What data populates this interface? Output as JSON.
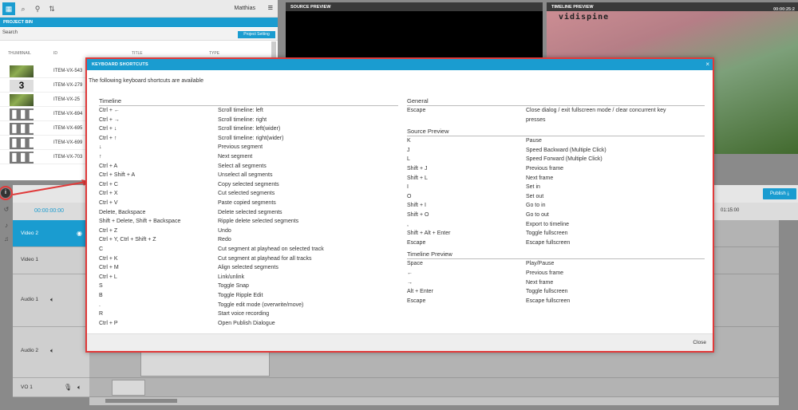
{
  "bin": {
    "user": "Matthias",
    "header": "PROJECT BIN",
    "search_placeholder": "Search",
    "settings_button": "Project Setting",
    "columns": [
      "THUMBNAIL",
      "ID",
      "TITLE",
      "TYPE"
    ],
    "rows": [
      {
        "thumb": "image",
        "id": "ITEM-VX-543"
      },
      {
        "thumb": "number",
        "thumb_text": "3",
        "id": "ITEM-VX-279"
      },
      {
        "thumb": "image",
        "id": "ITEM-VX-25"
      },
      {
        "thumb": "audio",
        "id": "ITEM-VX-694"
      },
      {
        "thumb": "audio",
        "id": "ITEM-VX-695"
      },
      {
        "thumb": "audio",
        "id": "ITEM-VX-699"
      },
      {
        "thumb": "audio",
        "id": "ITEM-VX-703"
      }
    ]
  },
  "previews": {
    "source_title": "SOURCE PREVIEW",
    "timeline_title": "TIMELINE PREVIEW",
    "timeline_time": "00:00:25:2",
    "logo_text": "vidispine"
  },
  "timeline": {
    "publish_label": "Publish",
    "start_time": "00:00:00:00",
    "end_time": "01:15:00",
    "tracks": [
      "Video 2",
      "Video 1",
      "Audio 1",
      "Audio 2",
      "VO 1"
    ]
  },
  "dialog": {
    "title": "KEYBOARD SHORTCUTS",
    "subtitle": "The following keyboard shortcuts are available",
    "close_label": "Close",
    "left_sections": [
      {
        "title": "Timeline",
        "items": [
          {
            "key": "Ctrl + ←",
            "desc": "Scroll timeline: left"
          },
          {
            "key": "Ctrl + →",
            "desc": "Scroll timeline: right"
          },
          {
            "key": "Ctrl + ↓",
            "desc": "Scroll timeline: left(wider)"
          },
          {
            "key": "Ctrl + ↑",
            "desc": "Scroll timeline: right(wider)"
          },
          {
            "key": "↓",
            "desc": "Previous segment"
          },
          {
            "key": "↑",
            "desc": "Next segment"
          },
          {
            "key": "Ctrl + A",
            "desc": "Select all segments"
          },
          {
            "key": "Ctrl + Shift + A",
            "desc": "Unselect all segments"
          },
          {
            "key": "Ctrl + C",
            "desc": "Copy selected segments"
          },
          {
            "key": "Ctrl + X",
            "desc": "Cut selected segments"
          },
          {
            "key": "Ctrl + V",
            "desc": "Paste copied segments"
          },
          {
            "key": "Delete, Backspace",
            "desc": "Delete selected segments"
          },
          {
            "key": "Shift + Delete, Shift + Backspace",
            "desc": "Ripple delete selected segments"
          },
          {
            "key": "Ctrl + Z",
            "desc": "Undo"
          },
          {
            "key": "Ctrl + Y, Ctrl + Shift + Z",
            "desc": "Redo"
          },
          {
            "key": "C",
            "desc": "Cut segment at playhead on selected track"
          },
          {
            "key": "Ctrl + K",
            "desc": "Cut segment at playhead for all tracks"
          },
          {
            "key": "Ctrl + M",
            "desc": "Align selected segments"
          },
          {
            "key": "Ctrl + L",
            "desc": "Link/unlink"
          },
          {
            "key": "S",
            "desc": "Toggle Snap"
          },
          {
            "key": "B",
            "desc": "Toggle Ripple Edit"
          },
          {
            "key": ".",
            "desc": "Toggle edit mode (overwrite/move)"
          },
          {
            "key": "R",
            "desc": "Start voice recording"
          },
          {
            "key": "Ctrl + P",
            "desc": "Open Publish Dialogue"
          }
        ]
      }
    ],
    "right_sections": [
      {
        "title": "General",
        "items": [
          {
            "key": "Escape",
            "desc": "Close dialog / exit fullscreen mode / clear concurrent key",
            "desc2": "presses"
          }
        ]
      },
      {
        "title": "Source Preview",
        "items": [
          {
            "key": "K",
            "desc": "Pause"
          },
          {
            "key": "J",
            "desc": "Speed Backward (Multiple Click)"
          },
          {
            "key": "L",
            "desc": "Speed Forward (Multiple Click)"
          },
          {
            "key": "Shift + J",
            "desc": "Previous frame"
          },
          {
            "key": "Shift + L",
            "desc": "Next frame"
          },
          {
            "key": "I",
            "desc": "Set in"
          },
          {
            "key": "O",
            "desc": "Set out"
          },
          {
            "key": "Shift + I",
            "desc": "Go to in"
          },
          {
            "key": "Shift + O",
            "desc": "Go to out"
          },
          {
            "key": ",",
            "desc": "Export to timeline"
          },
          {
            "key": "Shift + Alt + Enter",
            "desc": "Toggle fullscreen"
          },
          {
            "key": "Escape",
            "desc": "Escape fullscreen"
          }
        ]
      },
      {
        "title": "Timeline Preview",
        "items": [
          {
            "key": "Space",
            "desc": "Play/Pause"
          },
          {
            "key": "←",
            "desc": "Previous frame"
          },
          {
            "key": "→",
            "desc": "Next frame"
          },
          {
            "key": "Alt + Enter",
            "desc": "Toggle fullscreen"
          },
          {
            "key": "Escape",
            "desc": "Escape fullscreen"
          }
        ]
      }
    ]
  },
  "colors": {
    "accent": "#1a9cd0",
    "highlight": "#e03a3a"
  }
}
